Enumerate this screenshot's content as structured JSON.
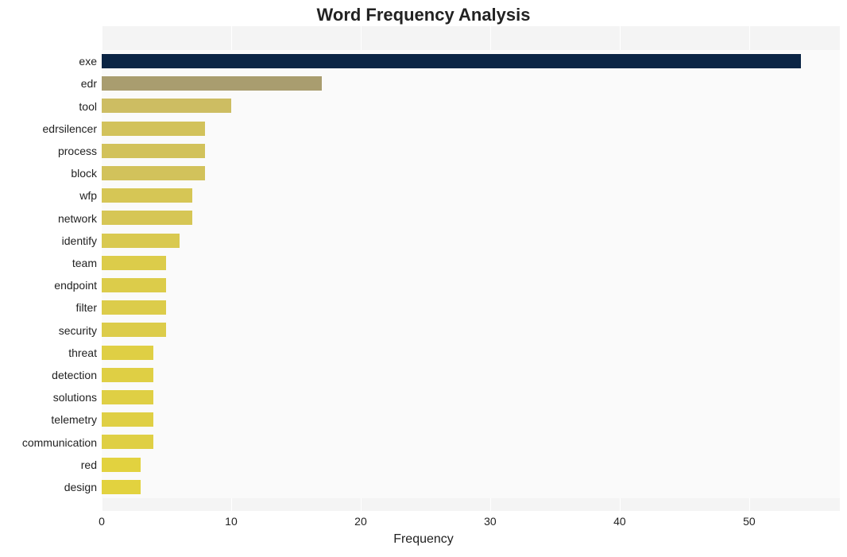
{
  "chart_data": {
    "type": "bar",
    "orientation": "horizontal",
    "title": "Word Frequency Analysis",
    "xlabel": "Frequency",
    "ylabel": "",
    "xlim": [
      0,
      57
    ],
    "xticks": [
      0,
      10,
      20,
      30,
      40,
      50
    ],
    "bars": [
      {
        "label": "exe",
        "value": 54,
        "color": "#0b2545"
      },
      {
        "label": "edr",
        "value": 17,
        "color": "#a99d6f"
      },
      {
        "label": "tool",
        "value": 10,
        "color": "#cdbd62"
      },
      {
        "label": "edrsilencer",
        "value": 8,
        "color": "#d2c25b"
      },
      {
        "label": "process",
        "value": 8,
        "color": "#d2c25b"
      },
      {
        "label": "block",
        "value": 8,
        "color": "#d2c25b"
      },
      {
        "label": "wfp",
        "value": 7,
        "color": "#d6c655"
      },
      {
        "label": "network",
        "value": 7,
        "color": "#d6c655"
      },
      {
        "label": "identify",
        "value": 6,
        "color": "#d9c950"
      },
      {
        "label": "team",
        "value": 5,
        "color": "#dccc4a"
      },
      {
        "label": "endpoint",
        "value": 5,
        "color": "#dccc4a"
      },
      {
        "label": "filter",
        "value": 5,
        "color": "#dccc4a"
      },
      {
        "label": "security",
        "value": 5,
        "color": "#dccc4a"
      },
      {
        "label": "threat",
        "value": 4,
        "color": "#dfcf44"
      },
      {
        "label": "detection",
        "value": 4,
        "color": "#dfcf44"
      },
      {
        "label": "solutions",
        "value": 4,
        "color": "#dfcf44"
      },
      {
        "label": "telemetry",
        "value": 4,
        "color": "#dfcf44"
      },
      {
        "label": "communication",
        "value": 4,
        "color": "#dfcf44"
      },
      {
        "label": "red",
        "value": 3,
        "color": "#e2d23f"
      },
      {
        "label": "design",
        "value": 3,
        "color": "#e2d23f"
      }
    ]
  }
}
